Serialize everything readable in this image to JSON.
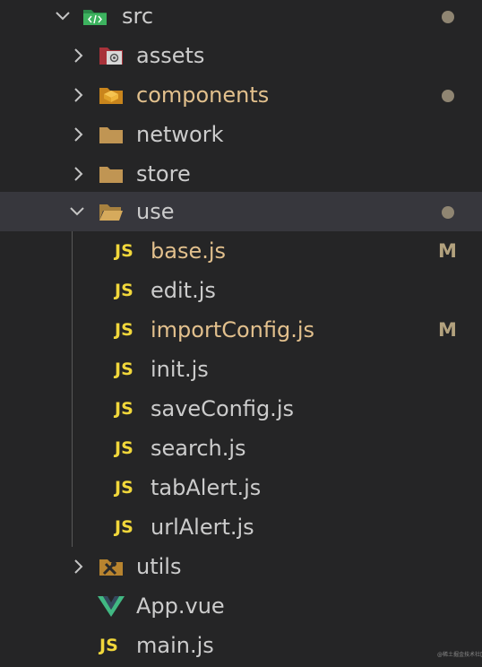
{
  "explorer": {
    "src": {
      "label": "src",
      "icon": "src-folder-icon",
      "status": "dot"
    },
    "assets": {
      "label": "assets",
      "icon": "assets-folder-icon"
    },
    "components": {
      "label": "components",
      "icon": "components-folder-icon",
      "status": "dot"
    },
    "network": {
      "label": "network",
      "icon": "folder-icon"
    },
    "store": {
      "label": "store",
      "icon": "folder-icon"
    },
    "use": {
      "label": "use",
      "icon": "folder-open-icon",
      "status": "dot",
      "files": [
        {
          "name": "base.js",
          "badge": "JS",
          "git": "M"
        },
        {
          "name": "edit.js",
          "badge": "JS"
        },
        {
          "name": "importConfig.js",
          "badge": "JS",
          "git": "M"
        },
        {
          "name": "init.js",
          "badge": "JS"
        },
        {
          "name": "saveConfig.js",
          "badge": "JS"
        },
        {
          "name": "search.js",
          "badge": "JS"
        },
        {
          "name": "tabAlert.js",
          "badge": "JS"
        },
        {
          "name": "urlAlert.js",
          "badge": "JS"
        }
      ]
    },
    "utils": {
      "label": "utils",
      "icon": "utils-folder-icon"
    },
    "app_vue": {
      "label": "App.vue",
      "icon": "vue-icon"
    },
    "main_js": {
      "label": "main.js",
      "badge": "JS"
    }
  },
  "watermark": "@稀土掘金技术社区",
  "colors": {
    "background": "#252526",
    "selected_row": "#37373d",
    "text": "#cccccc",
    "modified_text": "#e2c08d",
    "js_badge": "#f1d73b",
    "folder": "#c09553"
  }
}
